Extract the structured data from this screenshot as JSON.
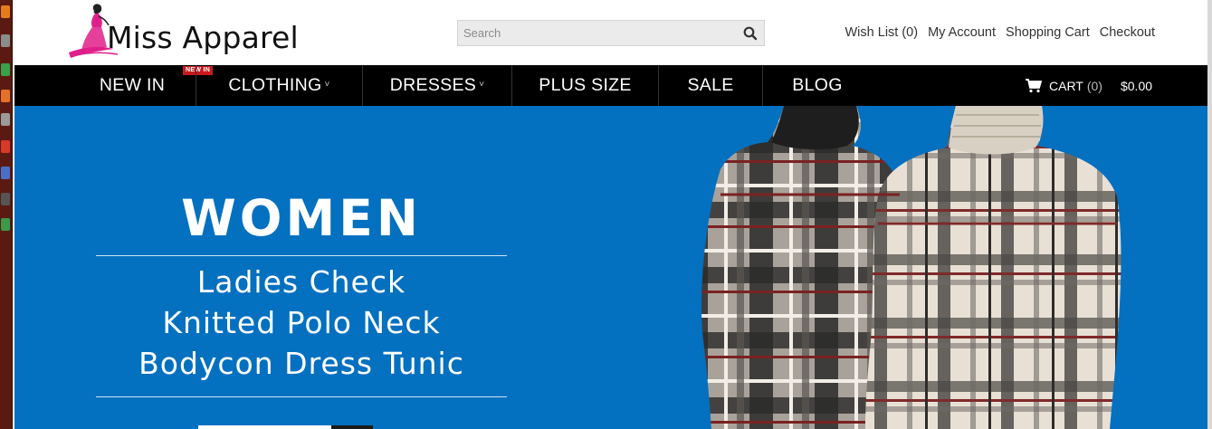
{
  "site": {
    "logo_text": "Miss Apparel"
  },
  "search": {
    "placeholder": "Search",
    "icon": "search-icon"
  },
  "top_links": {
    "wishlist": "Wish List (0)",
    "account": "My Account",
    "cart": "Shopping Cart",
    "checkout": "Checkout"
  },
  "nav": {
    "items": [
      {
        "label": "NEW IN"
      },
      {
        "label": "CLOTHING",
        "caret": "˅"
      },
      {
        "label": "DRESSES",
        "caret": "˅"
      },
      {
        "label": "PLUS SIZE"
      },
      {
        "label": "SALE"
      },
      {
        "label": "BLOG"
      }
    ],
    "badge": "NEW IN",
    "cart_label": "CART",
    "cart_count": "(0)",
    "cart_total": "$0.00",
    "cart_icon": "shopping-cart-icon"
  },
  "hero": {
    "title": "WOMEN",
    "subtitle_lines": [
      "Ladies Check",
      "Knitted Polo Neck",
      "Bodycon Dress Tunic"
    ]
  },
  "colors": {
    "hero_bg": "#0470c0",
    "nav_bg": "#000000",
    "badge_bg": "#c8191f",
    "logo_accent": "#e0208a"
  }
}
